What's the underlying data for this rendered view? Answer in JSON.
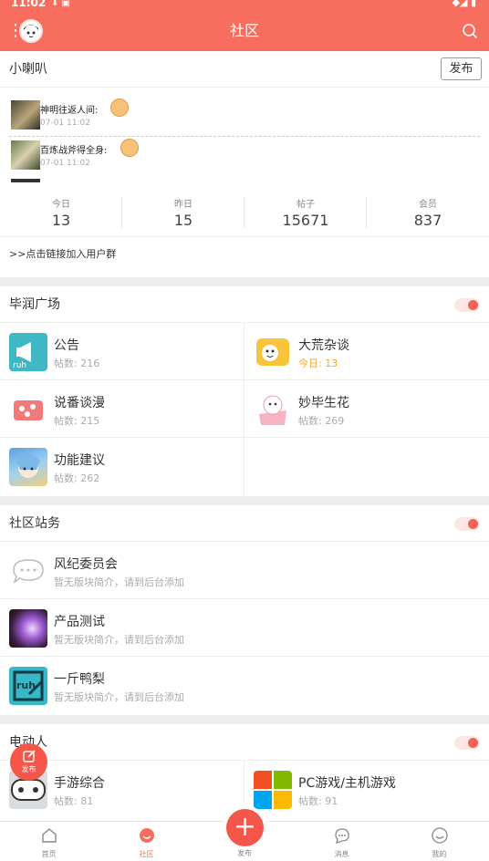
{
  "status_bar": {
    "time": "11:02"
  },
  "header": {
    "title": "社区"
  },
  "announce": {
    "title": "小喇叭",
    "publish_label": "发布",
    "items": [
      {
        "name": "神明往返人间:",
        "time": "07-01 11:02"
      },
      {
        "name": "百炼战斧得全身:",
        "time": "07-01 11:02"
      }
    ],
    "stats": [
      {
        "label": "今日",
        "value": "13"
      },
      {
        "label": "昨日",
        "value": "15"
      },
      {
        "label": "帖子",
        "value": "15671"
      },
      {
        "label": "会员",
        "value": "837"
      }
    ],
    "join_link": ">>点击链接加入用户群"
  },
  "sections": [
    {
      "title": "毕润广场",
      "boards": [
        {
          "name": "公告",
          "sub": "帖数: 216"
        },
        {
          "name": "大荒杂谈",
          "sub": "今日: 13"
        },
        {
          "name": "说番谈漫",
          "sub": "帖数: 215"
        },
        {
          "name": "妙毕生花",
          "sub": "帖数: 269"
        },
        {
          "name": "功能建议",
          "sub": "帖数: 262"
        }
      ]
    },
    {
      "title": "社区站务",
      "boards": [
        {
          "name": "风纪委员会",
          "sub": "暂无版块简介，请到后台添加"
        },
        {
          "name": "产品测试",
          "sub": "暂无版块简介，请到后台添加"
        },
        {
          "name": "一斤鸭梨",
          "sub": "暂无版块简介，请到后台添加"
        }
      ]
    },
    {
      "title": "电动人",
      "boards": [
        {
          "name": "手游综合",
          "sub": "帖数: 81"
        },
        {
          "name": "PC游戏/主机游戏",
          "sub": "帖数: 91"
        }
      ]
    }
  ],
  "fab_float_label": "发布",
  "tabs": [
    {
      "label": "首页"
    },
    {
      "label": "社区"
    },
    {
      "label": "发布"
    },
    {
      "label": "消息"
    },
    {
      "label": "我的"
    }
  ],
  "colors": {
    "accent": "#f76d5e",
    "today": "#f5a623"
  }
}
